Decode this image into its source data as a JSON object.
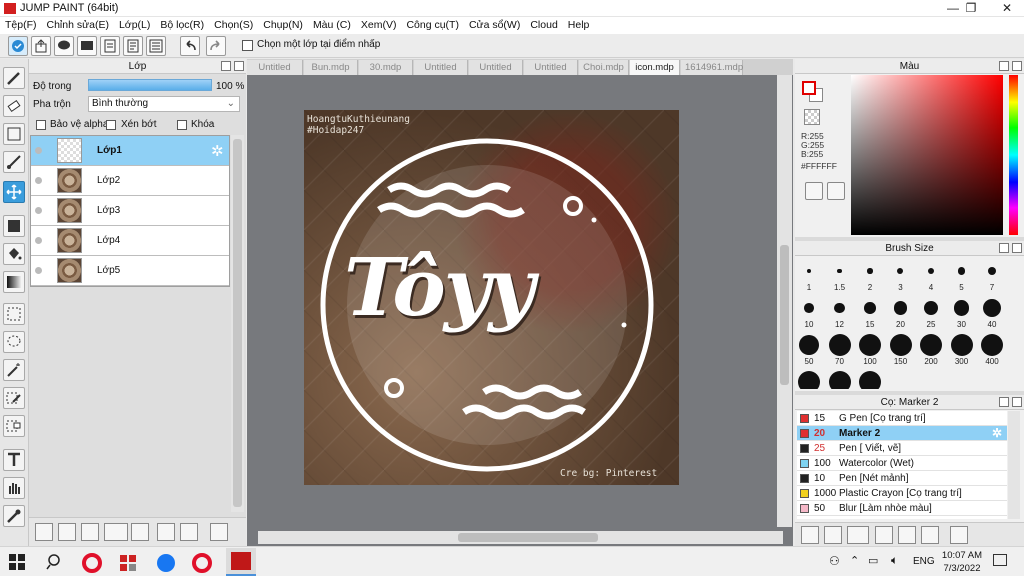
{
  "window": {
    "title": "JUMP PAINT (64bit)",
    "minimize": "—",
    "maximize": "❐",
    "close": "✕"
  },
  "menu": [
    "Tệp(F)",
    "Chỉnh sửa(E)",
    "Lớp(L)",
    "Bộ lọc(R)",
    "Chọn(S)",
    "Chụp(N)",
    "Màu (C)",
    "Xem(V)",
    "Công cụ(T)",
    "Cửa sổ(W)",
    "Cloud",
    "Help"
  ],
  "toolbar": {
    "snap_label": "Chọn một lớp tại điểm nhấp",
    "snap_checked": false
  },
  "layer_panel": {
    "title": "Lớp",
    "opacity_label": "Độ trong",
    "opacity_value": "100 %",
    "opacity": 1.0,
    "blend_label": "Pha trộn",
    "blend_value": "Bình thường",
    "protect_alpha": "Bảo vệ alpha",
    "clipping": "Xén bớt",
    "lock": "Khóa",
    "layers": [
      {
        "name": "Lớp1",
        "selected": true
      },
      {
        "name": "Lớp2",
        "selected": false
      },
      {
        "name": "Lớp3",
        "selected": false
      },
      {
        "name": "Lớp4",
        "selected": false
      },
      {
        "name": "Lớp5",
        "selected": false
      }
    ]
  },
  "tabs": [
    {
      "label": "Untitled",
      "active": false
    },
    {
      "label": "Bun.mdp",
      "active": false
    },
    {
      "label": "30.mdp",
      "active": false
    },
    {
      "label": "Untitled",
      "active": false
    },
    {
      "label": "Untitled",
      "active": false
    },
    {
      "label": "Untitled",
      "active": false
    },
    {
      "label": "Choi.mdp",
      "active": false
    },
    {
      "label": "icon.mdp",
      "active": true
    },
    {
      "label": "1614961.mdp",
      "active": false
    }
  ],
  "artwork": {
    "watermark_line1": "HoangtuKuthieunang",
    "watermark_line2": "#Hoidap247",
    "logo_text": "Tôyy",
    "credit": "Cre bg: Pinterest"
  },
  "color_panel": {
    "title": "Màu",
    "r": "R:255",
    "g": "G:255",
    "b": "B:255",
    "hex": "#FFFFFF",
    "foreground": "#FFFFFF",
    "accent": "#E00000"
  },
  "brush_panel": {
    "title": "Brush Size",
    "sizes": [
      "1",
      "1.5",
      "2",
      "3",
      "4",
      "5",
      "7",
      "10",
      "12",
      "15",
      "20",
      "25",
      "30",
      "40",
      "50",
      "70",
      "100",
      "150",
      "200",
      "300",
      "400"
    ]
  },
  "subtool_panel": {
    "title": "Cọ: Marker 2",
    "items": [
      {
        "size": "15",
        "name": "G Pen [Cọ trang trí]",
        "color": "#E03030",
        "selected": false
      },
      {
        "size": "20",
        "name": "Marker 2",
        "color": "#E03030",
        "selected": true
      },
      {
        "size": "25",
        "name": "Pen [ Viết, vẽ]",
        "color": "#222222",
        "selected": false
      },
      {
        "size": "100",
        "name": "Watercolor (Wet)",
        "color": "#7FD3F0",
        "selected": false
      },
      {
        "size": "10",
        "name": "Pen [Nét mảnh]",
        "color": "#222222",
        "selected": false
      },
      {
        "size": "1000",
        "name": "Plastic Crayon [Cọ trang trí]",
        "color": "#F0D020",
        "selected": false
      },
      {
        "size": "50",
        "name": "Blur [Làm nhòe màu]",
        "color": "#F5B8C8",
        "selected": false
      }
    ]
  },
  "taskbar": {
    "lang": "ENG",
    "time": "10:07 AM",
    "date": "7/3/2022"
  }
}
